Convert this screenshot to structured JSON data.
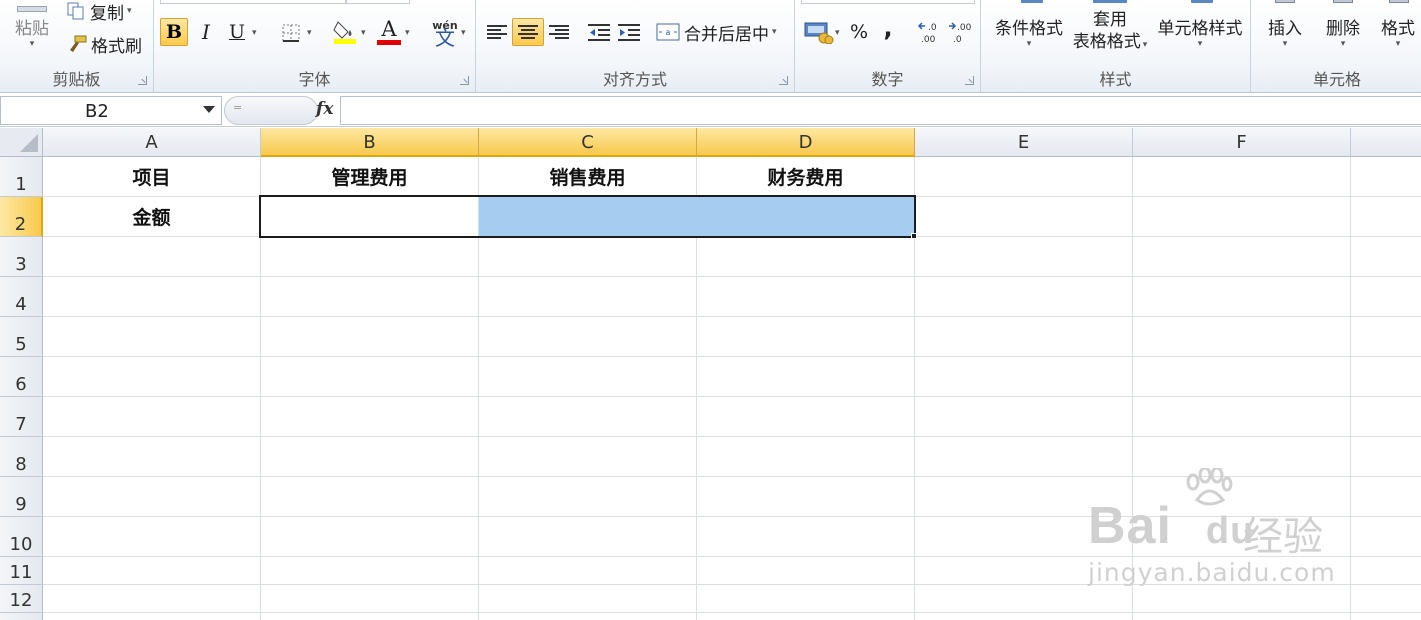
{
  "ribbon": {
    "clipboard": {
      "paste": "粘贴",
      "copy": "复制",
      "format_painter": "格式刷",
      "label": "剪贴板"
    },
    "font": {
      "bold": "B",
      "italic": "I",
      "underline": "U",
      "phonetic": "wén\n文",
      "font_color_letter": "A",
      "label": "字体"
    },
    "alignment": {
      "merge_center": "合并后居中",
      "label": "对齐方式"
    },
    "number": {
      "percent": "%",
      "comma": ",",
      "increase_decimal": ".0\n.00",
      "decrease_decimal": ".00\n.0",
      "label": "数字"
    },
    "styles": {
      "conditional_format": "条件格式",
      "table_format_line1": "套用",
      "table_format_line2": "表格格式",
      "cell_styles": "单元格样式",
      "label": "样式"
    },
    "cells": {
      "insert": "插入",
      "delete": "删除",
      "format": "格式",
      "label": "单元格"
    }
  },
  "formula_bar": {
    "name_box": "B2",
    "fx": "fx",
    "pill_hint": "=",
    "formula": ""
  },
  "columns": [
    "A",
    "B",
    "C",
    "D",
    "E",
    "F"
  ],
  "rows": [
    "1",
    "2",
    "3",
    "4",
    "5",
    "6",
    "7",
    "8",
    "9",
    "10",
    "11",
    "12"
  ],
  "cells": {
    "A1": "项目",
    "B1": "管理费用",
    "C1": "销售费用",
    "D1": "财务费用",
    "A2": "金额"
  },
  "selection": {
    "active": "B2",
    "range": "B2:D2"
  },
  "watermark": {
    "brand": "Bai",
    "brand2": "du",
    "cn": "经验",
    "url": "jingyan.baidu.com"
  },
  "colors": {
    "selection_fill": "#a6cdf0",
    "header_selected": "#f8c94c",
    "accent_red": "#e00000"
  }
}
